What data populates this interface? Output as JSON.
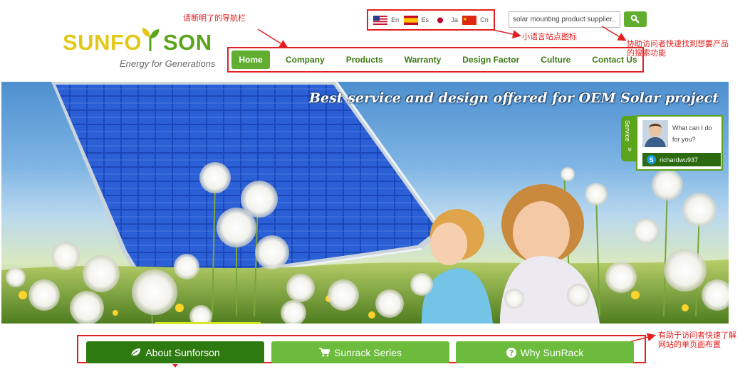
{
  "logo": {
    "brand_part1": "SUNFO",
    "brand_part2": "SON",
    "tagline": "Energy for Generations"
  },
  "languages": [
    {
      "code": "En",
      "flag": "us-flag-icon"
    },
    {
      "code": "Es",
      "flag": "es-flag-icon"
    },
    {
      "code": "Ja",
      "flag": "jp-flag-icon"
    },
    {
      "code": "Cn",
      "flag": "cn-flag-icon"
    }
  ],
  "search": {
    "value": "solar mounting product supplier...",
    "icon": "search-icon"
  },
  "nav": {
    "items": [
      "Home",
      "Company",
      "Products",
      "Warranty",
      "Design Factor",
      "Culture",
      "Contact Us"
    ],
    "active": "Home"
  },
  "annotations": {
    "nav": "请断明了的导航栏",
    "lang": "小语言站点图标",
    "search": "协助访问者快速找到想要产品的搜索功能",
    "buttons": "有助于访问者快速了解网站的单页面布置"
  },
  "banner": {
    "slogan": "Best service and design offered for OEM Solar project"
  },
  "service": {
    "tab_label": "Service",
    "message": "What can I do for you?",
    "username": "richardwu937"
  },
  "buttons": [
    {
      "label": "About Sunforson",
      "icon": "leaf-icon"
    },
    {
      "label": "Sunrack Series",
      "icon": "cart-icon"
    },
    {
      "label": "Why SunRack",
      "icon": "question-icon"
    }
  ],
  "colors": {
    "brand_green": "#62ae31",
    "dark_green": "#2d7a10",
    "brand_yellow": "#e2c81a",
    "annotation_red": "#e32020"
  }
}
